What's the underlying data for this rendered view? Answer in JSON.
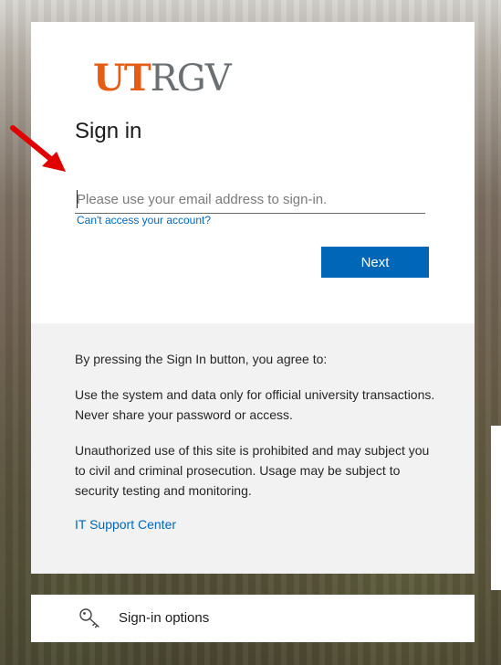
{
  "logo": {
    "ut": "UT",
    "rgv": "RGV",
    "accent_color": "#e65c14",
    "gray_color": "#6b6f72"
  },
  "signin": {
    "title": "Sign in",
    "email_placeholder": "Please use your email address to sign-in.",
    "email_value": "",
    "cant_access_link": "Can't access your account?",
    "next_label": "Next",
    "button_color": "#0067b8"
  },
  "notice": {
    "agreement": "By pressing the Sign In button, you agree to:",
    "usage": "Use the system and data only for official university transactions. Never share your password or access.",
    "warning": "Unauthorized use of this site is prohibited and may subject you to civil and criminal prosecution. Usage may be subject to security testing and monitoring.",
    "support_link": "IT Support Center"
  },
  "options": {
    "label": "Sign-in options",
    "icon": "key-icon"
  },
  "annotation": {
    "icon": "red-arrow-icon",
    "color": "#e00000"
  }
}
